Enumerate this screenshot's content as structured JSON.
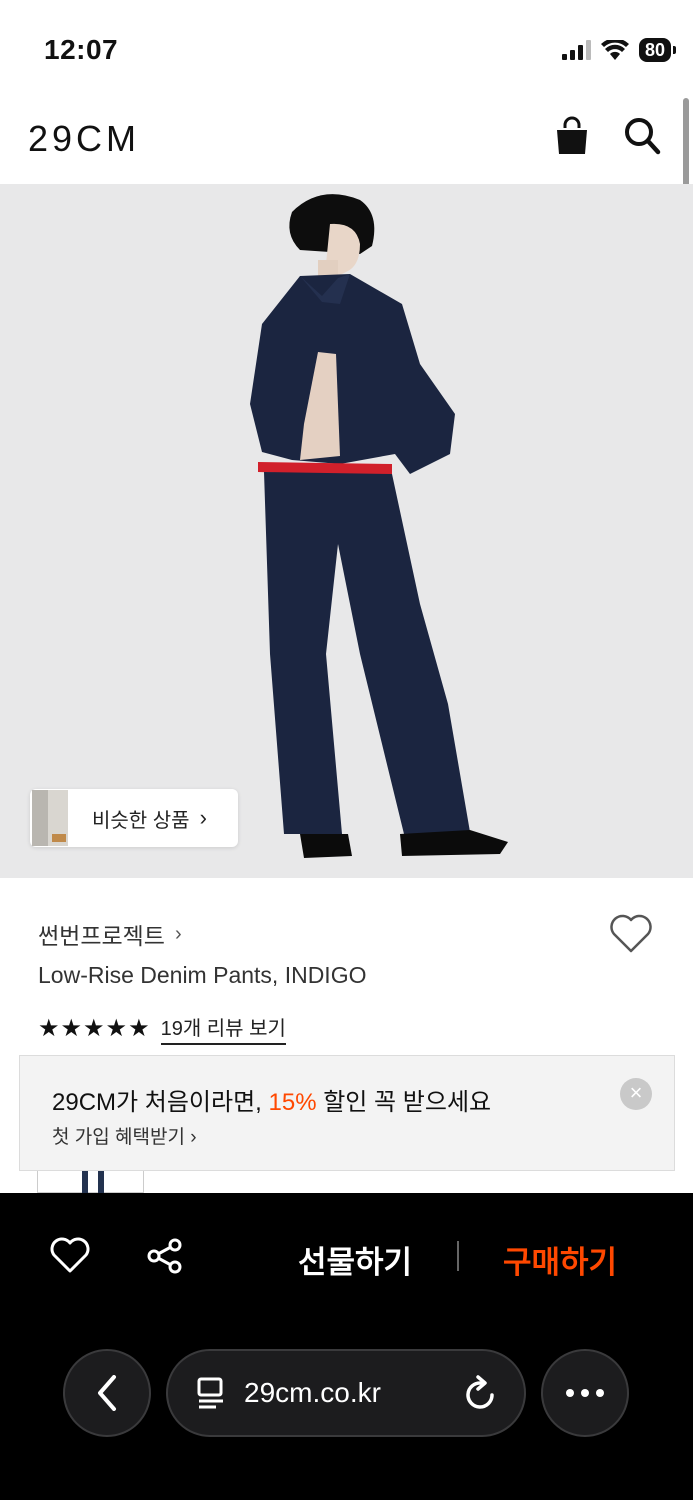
{
  "status": {
    "time": "12:07",
    "battery": "80"
  },
  "header": {
    "logo": "29CM"
  },
  "image": {
    "similar_label": "비슷한 상품",
    "similar_chevron": "›"
  },
  "product": {
    "brand": "썬번프로젝트",
    "brand_chevron": "›",
    "name": "Low-Rise Denim Pants, INDIGO",
    "stars": "★★★★★",
    "rating": 5,
    "review_link": "19개 리뷰 보기"
  },
  "promo": {
    "title_pre": "29CM가 처음이라면, ",
    "title_highlight": "15%",
    "title_post": " 할인 꼭 받으세요",
    "subtitle": "첫 가입 혜택받기 ›",
    "close": "×"
  },
  "actions": {
    "gift_label": "선물하기",
    "buy_label": "구매하기"
  },
  "browser": {
    "url": "29cm.co.kr"
  },
  "colors": {
    "accent": "#ff4800",
    "image_bg": "#e8e8e9",
    "denim": "#1b2540"
  }
}
